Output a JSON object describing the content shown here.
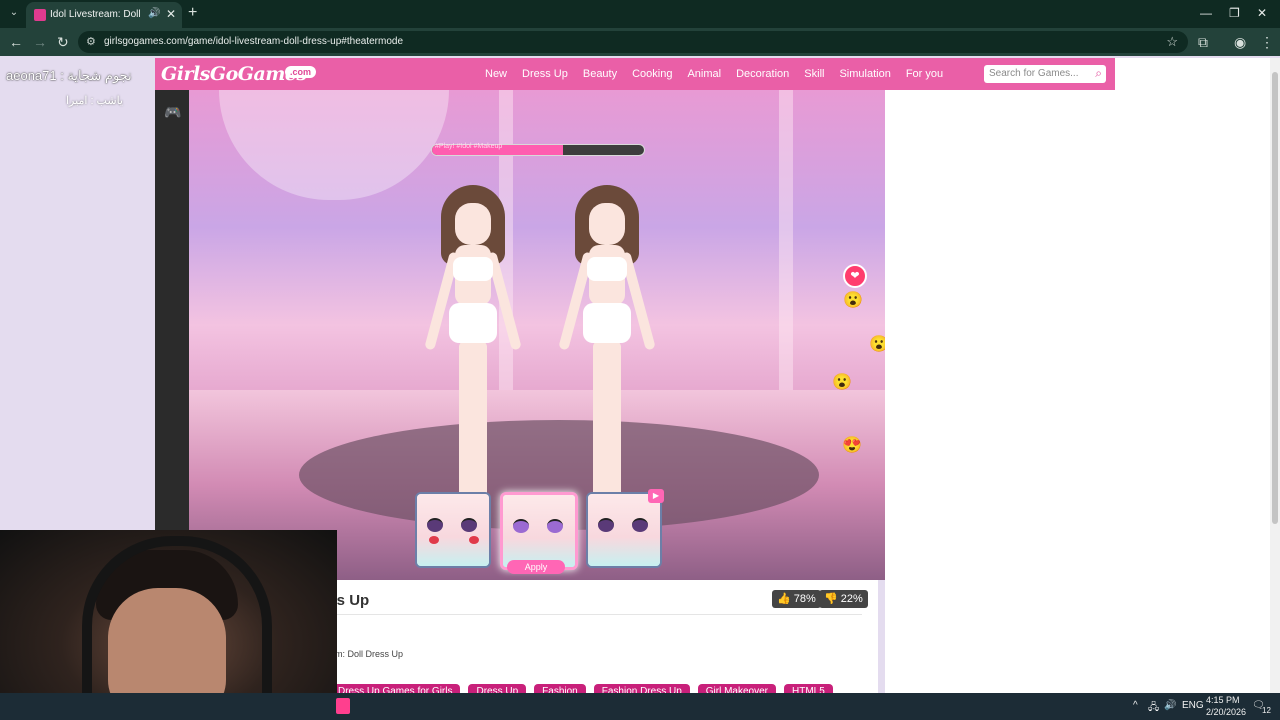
{
  "browser": {
    "tab_title": "Idol Livestream: Doll Dress",
    "url": "girlsgogames.com/game/idol-livestream-doll-dress-up#theatermode"
  },
  "overlay": {
    "streamer_name": "aeona71 : نجوم شجاية",
    "subtitle": "ياشب : اميرا"
  },
  "site": {
    "logo": "GirlsGoGames",
    "logo_suffix": ".com",
    "nav": [
      "New",
      "Dress Up",
      "Beauty",
      "Cooking",
      "Animal",
      "Decoration",
      "Skill",
      "Simulation",
      "For you"
    ],
    "search_placeholder": "Search for Games..."
  },
  "game": {
    "progress_fraction": 0.62,
    "progress_text": "#Play! #Idol #Makeup",
    "apply_label": "Apply",
    "face_cards": [
      "face-option-1",
      "face-option-2",
      "face-option-3"
    ],
    "reactions": [
      "😮",
      "😮",
      "😮",
      "😍",
      "❤"
    ]
  },
  "info": {
    "title_partial": "ess Up",
    "likes": "78%",
    "dislikes": "22%",
    "team": "am: Doll Dress Up",
    "tags": [
      "Dress Up Games for Girls",
      "Dress Up",
      "Fashion",
      "Fashion Dress Up",
      "Girl Makeover",
      "HTML5"
    ]
  },
  "taskbar": {
    "lang": "ENG",
    "time": "4:15 PM",
    "date": "2/20/2026",
    "notif_count": "12"
  },
  "colors": {
    "site_header": "#ea5fa7",
    "tag": "#c8207a",
    "browser_dark": "#0f2a22"
  }
}
